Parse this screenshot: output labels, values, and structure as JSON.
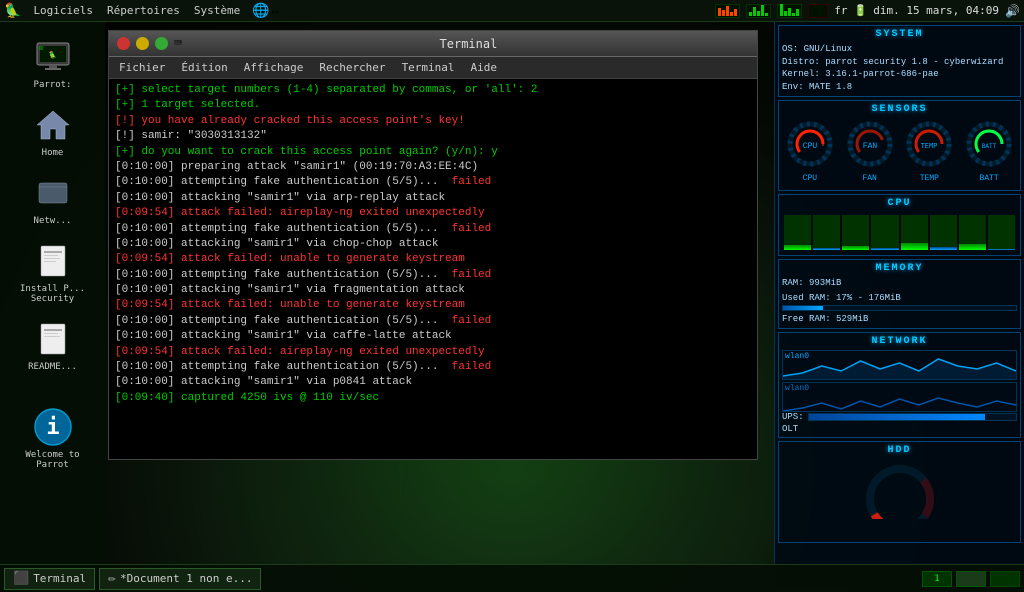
{
  "taskbar_top": {
    "menus": [
      "Logiciels",
      "Répertoires",
      "Système"
    ],
    "right": {
      "keyboard": "fr",
      "battery": "🔋",
      "datetime": "dim. 15 mars, 04:09",
      "wifi_icon": "wifi",
      "volume_icon": "volume"
    }
  },
  "system_widget": {
    "title": "SYSTEM",
    "os": "OS: GNU/Linux",
    "distro": "Distro: parrot security 1.8 - cyberwizard",
    "kernel": "Kernel: 3.16.1-parrot-686-pae",
    "env": "Env: MATE 1.8",
    "sensors_title": "SENSORS",
    "cpu_title": "CPU",
    "memory_title": "MEMORY",
    "ram_total": "RAM: 993MiB",
    "ram_used": "Used RAM: 17% - 176MiB",
    "ram_free": "Free RAM: 529MiB",
    "network_title": "NETWORK",
    "net_label1": "wlan0",
    "net_label2": "wlan0",
    "ups_label": "UPS:",
    "hdd_title": "HDD",
    "cpu_bars": [
      15,
      8,
      12,
      6,
      20,
      10,
      18,
      5
    ]
  },
  "sidebar": {
    "items": [
      {
        "label": "Parrot:",
        "icon": "🦜",
        "id": "parrot"
      },
      {
        "label": "Home",
        "icon": "🏠",
        "id": "home"
      },
      {
        "label": "Netw...",
        "icon": "📁",
        "id": "network"
      },
      {
        "label": "Install P... Security",
        "icon": "📄",
        "id": "install"
      },
      {
        "label": "README...",
        "icon": "📄",
        "id": "readme"
      },
      {
        "label": "Welcome to Parrot",
        "icon": "ℹ",
        "id": "welcome"
      }
    ]
  },
  "terminal": {
    "title": "Terminal",
    "title_icon": "⌨",
    "menu_items": [
      "Fichier",
      "Édition",
      "Affichage",
      "Rechercher",
      "Terminal",
      "Aide"
    ],
    "lines": [
      {
        "color": "green",
        "text": "[+] select target numbers (1-4) separated by commas, or 'all': 2"
      },
      {
        "color": "green",
        "text": "[+] 1 target selected."
      },
      {
        "color": "white",
        "text": ""
      },
      {
        "color": "red",
        "text": "[!] you have already cracked this access point's key!"
      },
      {
        "color": "white",
        "text": "[!] samir: \"3030313132\""
      },
      {
        "color": "green",
        "text": "[+] do you want to crack this access point again? (y/n): y"
      },
      {
        "color": "white",
        "text": ""
      },
      {
        "color": "white",
        "text": "[0:10:00] preparing attack \"samir1\" (00:19:70:A3:EE:4C)"
      },
      {
        "color": "white",
        "text": "[0:10:00] attempting fake authentication (5/5)...  failed"
      },
      {
        "color": "white",
        "text": "[0:10:00] attacking \"samir1\" via arp-replay attack"
      },
      {
        "color": "red",
        "text": "[0:09:54] attack failed: aireplay-ng exited unexpectedly"
      },
      {
        "color": "white",
        "text": "[0:10:00] attempting fake authentication (5/5)...  failed"
      },
      {
        "color": "white",
        "text": "[0:10:00] attacking \"samir1\" via chop-chop attack"
      },
      {
        "color": "red",
        "text": "[0:09:54] attack failed: unable to generate keystream"
      },
      {
        "color": "white",
        "text": "[0:10:00] attempting fake authentication (5/5)...  failed"
      },
      {
        "color": "white",
        "text": "[0:10:00] attacking \"samir1\" via fragmentation attack"
      },
      {
        "color": "red",
        "text": "[0:09:54] attack failed: unable to generate keystream"
      },
      {
        "color": "white",
        "text": "[0:10:00] attempting fake authentication (5/5)...  failed"
      },
      {
        "color": "white",
        "text": "[0:10:00] attacking \"samir1\" via caffe-latte attack"
      },
      {
        "color": "red",
        "text": "[0:09:54] attack failed: aireplay-ng exited unexpectedly"
      },
      {
        "color": "white",
        "text": "[0:10:00] attempting fake authentication (5/5)...  failed"
      },
      {
        "color": "white",
        "text": "[0:10:00] attacking \"samir1\" via p0841 attack"
      },
      {
        "color": "green",
        "text": "[0:09:40] captured 4250 ivs @ 110 iv/sec"
      }
    ]
  },
  "taskbar_bottom": {
    "items": [
      {
        "id": "terminal-btn",
        "icon": "⬛",
        "label": "Terminal"
      },
      {
        "id": "doc-btn",
        "icon": "✏",
        "label": "*Document 1 non e..."
      }
    ],
    "indicator": "1",
    "indicator2": ""
  }
}
